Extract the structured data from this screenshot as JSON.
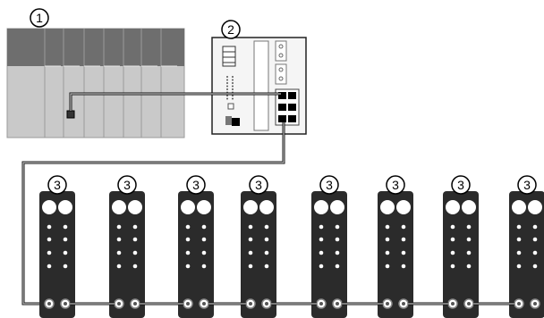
{
  "callouts": {
    "plc": "1",
    "gateway": "2",
    "io_module": "3"
  },
  "io_modules": [
    {
      "callout": "3"
    },
    {
      "callout": "3"
    },
    {
      "callout": "3"
    },
    {
      "callout": "3"
    },
    {
      "callout": "3"
    },
    {
      "callout": "3"
    },
    {
      "callout": "3"
    },
    {
      "callout": "3"
    }
  ],
  "colors": {
    "plc_dark": "#6e6e6e",
    "plc_light": "#c8c8c8",
    "module_body": "#2b2b2b",
    "cable": "#b0b0b0",
    "port": "#000000"
  }
}
